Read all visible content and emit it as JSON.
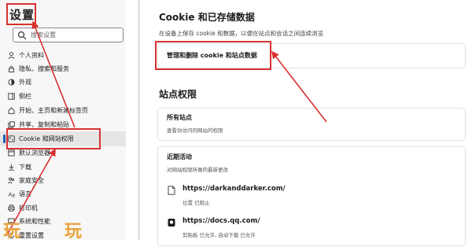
{
  "sidebar": {
    "title": "设置",
    "search_placeholder": "搜索设置",
    "items": [
      {
        "label": "个人资料",
        "icon": "person-icon"
      },
      {
        "label": "隐私、搜索和服务",
        "icon": "lock-icon"
      },
      {
        "label": "外观",
        "icon": "appearance-icon"
      },
      {
        "label": "侧栏",
        "icon": "sidebar-icon"
      },
      {
        "label": "开始、主页和新建标签页",
        "icon": "home-icon"
      },
      {
        "label": "共享、复制和粘贴",
        "icon": "share-icon"
      },
      {
        "label": "Cookie 和网站权限",
        "icon": "cookie-icon",
        "active": true
      },
      {
        "label": "默认浏览器",
        "icon": "browser-icon"
      },
      {
        "label": "下载",
        "icon": "download-icon"
      },
      {
        "label": "家庭安全",
        "icon": "family-icon"
      },
      {
        "label": "语言",
        "icon": "language-icon"
      },
      {
        "label": "打印机",
        "icon": "printer-icon"
      },
      {
        "label": "系统和性能",
        "icon": "system-icon"
      },
      {
        "label": "重置设置",
        "icon": "reset-icon"
      }
    ]
  },
  "main": {
    "cookie_title": "Cookie 和已存储数据",
    "cookie_description": "在设备上保存 cookie 和数据，以便在站点和会话之间连续浏览",
    "manage_label": "管理和删除 cookie 和站点数据",
    "site_permissions_title": "站点权限",
    "all_sites": {
      "title": "所有站点",
      "description": "查看你访问的网站的权限"
    },
    "recent_activity": {
      "title": "近期活动",
      "description": "对网站权限所做的最新更改",
      "sites": [
        {
          "url": "https://darkanddarker.com/",
          "permissions": "位置 已阻止",
          "icon": "document-icon"
        },
        {
          "url": "https://docs.qq.com/",
          "permissions": "剪贴板 已允许, 自动下载 已允许",
          "icon": "qq-site-icon"
        }
      ]
    }
  },
  "watermark": {
    "left": "玩",
    "right": "玩"
  },
  "colors": {
    "highlight": "#d93030",
    "active_bar": "#1a5fb4",
    "watermark": "#e8a33c"
  }
}
